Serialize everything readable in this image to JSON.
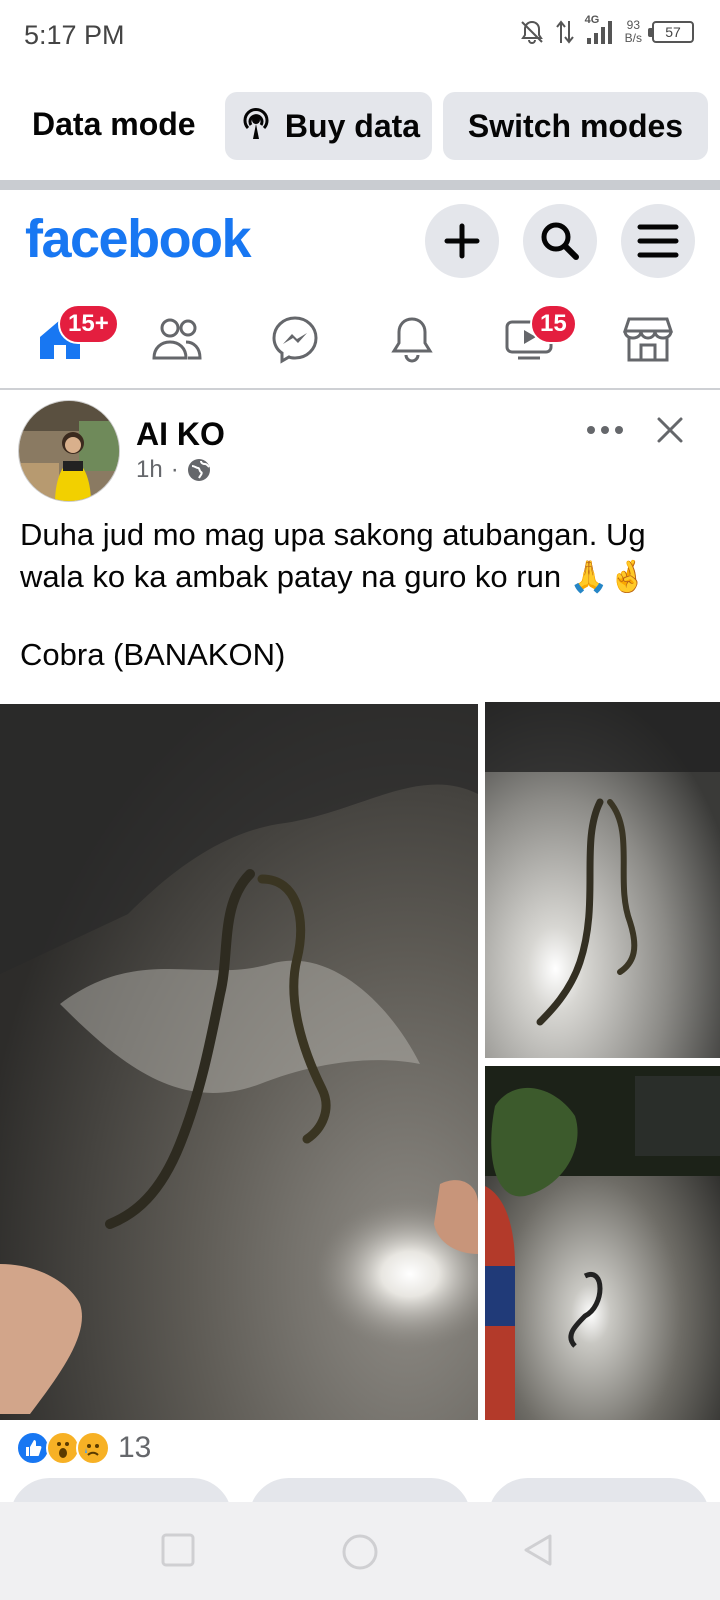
{
  "status_bar": {
    "time": "5:17 PM",
    "net_type": "4G",
    "net_speed_value": "93",
    "net_speed_unit": "B/s",
    "battery": "57"
  },
  "data_mode": {
    "label": "Data mode",
    "buy_data": "Buy data",
    "switch_modes": "Switch modes"
  },
  "header": {
    "logo": "facebook",
    "brand_color": "#1877f2"
  },
  "nav_tabs": [
    {
      "name": "home",
      "icon": "home-icon",
      "badge": "15+",
      "active": true
    },
    {
      "name": "friends",
      "icon": "friends-icon",
      "badge": ""
    },
    {
      "name": "messenger",
      "icon": "messenger-icon",
      "badge": ""
    },
    {
      "name": "notifications",
      "icon": "bell-icon",
      "badge": ""
    },
    {
      "name": "watch",
      "icon": "video-icon",
      "badge": "15"
    },
    {
      "name": "marketplace",
      "icon": "marketplace-icon",
      "badge": ""
    }
  ],
  "post": {
    "author": "AI KO",
    "time": "1h",
    "separator": "·",
    "privacy_icon": "globe-icon",
    "text_line1": "Duha jud mo mag upa sakong atubangan. Ug",
    "text_line2": "wala ko ka ambak patay na guro ko run 🙏🤞",
    "text_line3": "Cobra (BANAKON)",
    "reaction_icons": [
      "like-icon",
      "wow-icon",
      "sad-icon"
    ],
    "reaction_count": "13"
  },
  "colors": {
    "badge": "#e41e3f",
    "pill_bg": "#e4e6eb",
    "like": "#1877f2"
  }
}
